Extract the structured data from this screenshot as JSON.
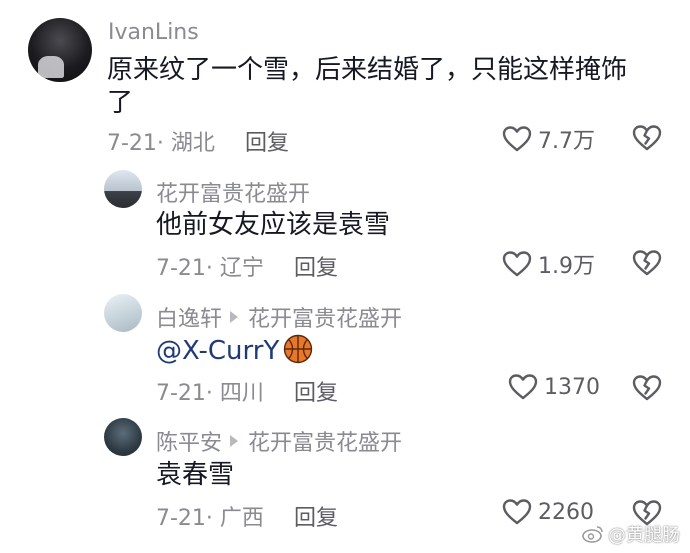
{
  "comments": [
    {
      "username": "IvanLins",
      "text_line1": "原来纹了一个雪，后来结婚了，只能这样掩饰",
      "text_line2": "了",
      "meta": "7-21· 湖北",
      "reply_label": "回复",
      "likes": "7.7万"
    },
    {
      "username": "花开富贵花盛开",
      "text": "他前女友应该是袁雪",
      "meta": "7-21· 辽宁",
      "reply_label": "回复",
      "likes": "1.9万"
    },
    {
      "username": "白逸轩",
      "reply_to": "花开富贵花盛开",
      "mention": "@X-CurrY",
      "emoji": "basketball",
      "meta": "7-21· 四川",
      "reply_label": "回复",
      "likes": "1370"
    },
    {
      "username": "陈平安",
      "reply_to": "花开富贵花盛开",
      "text": "袁春雪",
      "meta": "7-21· 广西",
      "reply_label": "回复",
      "likes": "2260"
    }
  ],
  "watermark": {
    "logo": "weibo-logo-icon",
    "text": "@黄腿肠"
  },
  "icons": {
    "like": "heart-outline-icon",
    "dislike": "broken-heart-icon",
    "reply_arrow": "triangle-right-icon"
  },
  "colors": {
    "text": "#161823",
    "secondary": "#8a8b91",
    "mention": "#1e3b77"
  }
}
